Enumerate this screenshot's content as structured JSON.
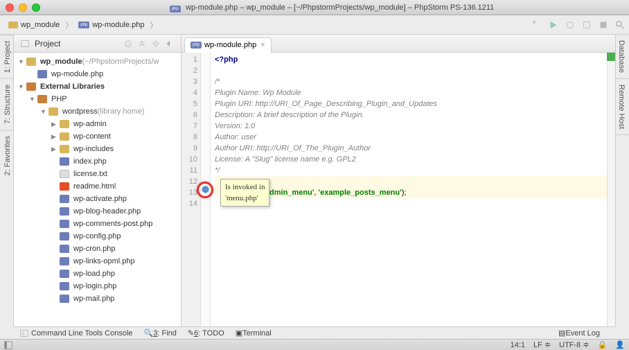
{
  "window": {
    "title": "wp-module.php – wp_module – [~/PhpstormProjects/wp_module] – PhpStorm PS-136.1211",
    "file_icon": "php"
  },
  "breadcrumb": {
    "items": [
      {
        "icon": "folder",
        "label": "wp_module"
      },
      {
        "icon": "php",
        "label": "wp-module.php"
      }
    ]
  },
  "left_tabs": [
    "1: Project",
    "7: Structure",
    "2: Favorites"
  ],
  "right_tabs": [
    "Database",
    "Remote Host"
  ],
  "project_panel": {
    "title": "Project",
    "tree": [
      {
        "indent": 0,
        "toggle": "▼",
        "icon": "folder",
        "label": "wp_module",
        "suffix": " (~/PhpstormProjects/w",
        "bold": true
      },
      {
        "indent": 1,
        "toggle": "",
        "icon": "php",
        "label": "wp-module.php"
      },
      {
        "indent": 0,
        "toggle": "▼",
        "icon": "lib",
        "label": "External Libraries",
        "bold": true
      },
      {
        "indent": 1,
        "toggle": "▼",
        "icon": "lib",
        "label": "PHP"
      },
      {
        "indent": 2,
        "toggle": "▼",
        "icon": "folder",
        "label": "wordpress",
        "suffix": " (library home)"
      },
      {
        "indent": 3,
        "toggle": "▶",
        "icon": "folder",
        "label": "wp-admin"
      },
      {
        "indent": 3,
        "toggle": "▶",
        "icon": "folder",
        "label": "wp-content"
      },
      {
        "indent": 3,
        "toggle": "▶",
        "icon": "folder",
        "label": "wp-includes"
      },
      {
        "indent": 3,
        "toggle": "",
        "icon": "php",
        "label": "index.php"
      },
      {
        "indent": 3,
        "toggle": "",
        "icon": "txt",
        "label": "license.txt"
      },
      {
        "indent": 3,
        "toggle": "",
        "icon": "html",
        "label": "readme.html"
      },
      {
        "indent": 3,
        "toggle": "",
        "icon": "php",
        "label": "wp-activate.php"
      },
      {
        "indent": 3,
        "toggle": "",
        "icon": "php",
        "label": "wp-blog-header.php"
      },
      {
        "indent": 3,
        "toggle": "",
        "icon": "php",
        "label": "wp-comments-post.php"
      },
      {
        "indent": 3,
        "toggle": "",
        "icon": "php",
        "label": "wp-config.php"
      },
      {
        "indent": 3,
        "toggle": "",
        "icon": "php",
        "label": "wp-cron.php"
      },
      {
        "indent": 3,
        "toggle": "",
        "icon": "php",
        "label": "wp-links-opml.php"
      },
      {
        "indent": 3,
        "toggle": "",
        "icon": "php",
        "label": "wp-load.php"
      },
      {
        "indent": 3,
        "toggle": "",
        "icon": "php",
        "label": "wp-login.php"
      },
      {
        "indent": 3,
        "toggle": "",
        "icon": "php",
        "label": "wp-mail.php"
      }
    ]
  },
  "editor": {
    "tab": {
      "label": "wp-module.php"
    },
    "line_count": 14,
    "lines": {
      "l1": "<?php",
      "l3": "/*",
      "l4": "Plugin Name: Wp Module",
      "l5": "Plugin URI: http://URI_Of_Page_Describing_Plugin_and_Updates",
      "l6": "Description: A brief description of the Plugin.",
      "l7": "Version: 1.0",
      "l8": "Author: user",
      "l9": "Author URI: http://URI_Of_The_Plugin_Author",
      "l10": "License: A \"Slug\" license name e.g. GPL2",
      "l11": "*/",
      "l13_str1": "'admin_menu'",
      "l13_str2": "'example_posts_menu'",
      "l13_punc1": ", ",
      "l13_punc2": ");"
    },
    "tooltip": "Is invoked in\n'menu.php'"
  },
  "bottom_bar": {
    "items": [
      {
        "label": "Command Line Tools Console"
      },
      {
        "underline": "3",
        "label": ": Find"
      },
      {
        "underline": "6",
        "label": ": TODO"
      },
      {
        "label": "Terminal"
      }
    ],
    "right": "Event Log"
  },
  "status_bar": {
    "cursor": "14:1",
    "line_ending": "LF",
    "encoding": "UTF-8"
  }
}
